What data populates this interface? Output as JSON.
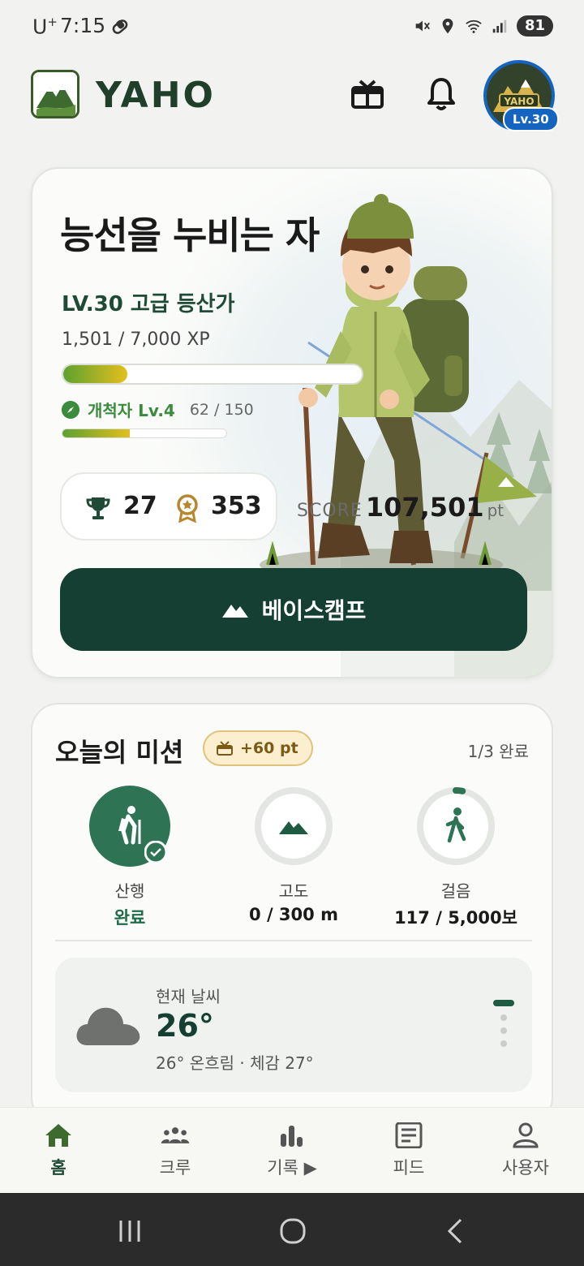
{
  "status_bar": {
    "carrier": "U",
    "carrier_sup": "+",
    "time": "7:15",
    "battery": "81"
  },
  "header": {
    "logo_text": "YAHO",
    "avatar_badge": "Lv.30",
    "avatar_text": "YAHO"
  },
  "hero": {
    "title": "능선을 누비는 자",
    "level_title": "LV.30 고급 등산가",
    "xp_text": "1,501 / 7,000 XP",
    "xp_progress": 0.2144,
    "sub_level_name": "개척자 Lv.4",
    "sub_level_xp": "62 / 150",
    "sub_level_progress": 0.4133,
    "trophies": "27",
    "medals": "353",
    "score_label": "SCORE",
    "score_value": "107,501",
    "score_unit": "pt",
    "basecamp_label": "베이스캠프"
  },
  "mission": {
    "title": "오늘의 미션",
    "reward": "+60 pt",
    "progress": "1/3 완료",
    "items": [
      {
        "label": "산행",
        "value": "완료",
        "icon": "hiker-icon",
        "progress": 1.0
      },
      {
        "label": "고도",
        "value": "0 / 300 m",
        "icon": "mountain-icon",
        "progress": 0.0
      },
      {
        "label": "걸음",
        "value": "117 / 5,000보",
        "icon": "walk-icon",
        "progress": 0.0234
      }
    ],
    "weather": {
      "label": "현재 날씨",
      "temp": "26°",
      "desc": "26° 온흐림 · 체감 27°"
    }
  },
  "bottom_nav": [
    {
      "label": "홈",
      "icon": "home-icon",
      "active": true
    },
    {
      "label": "크루",
      "icon": "crew-icon",
      "active": false
    },
    {
      "label": "기록 ▶",
      "icon": "chart-icon",
      "active": false
    },
    {
      "label": "피드",
      "icon": "feed-icon",
      "active": false
    },
    {
      "label": "사용자",
      "icon": "user-icon",
      "active": false
    }
  ],
  "colors": {
    "brand_dark": "#143f32",
    "brand_green": "#1f6b4a",
    "accent_gold": "#e3bf1d",
    "avatar_blue": "#1565c0"
  }
}
